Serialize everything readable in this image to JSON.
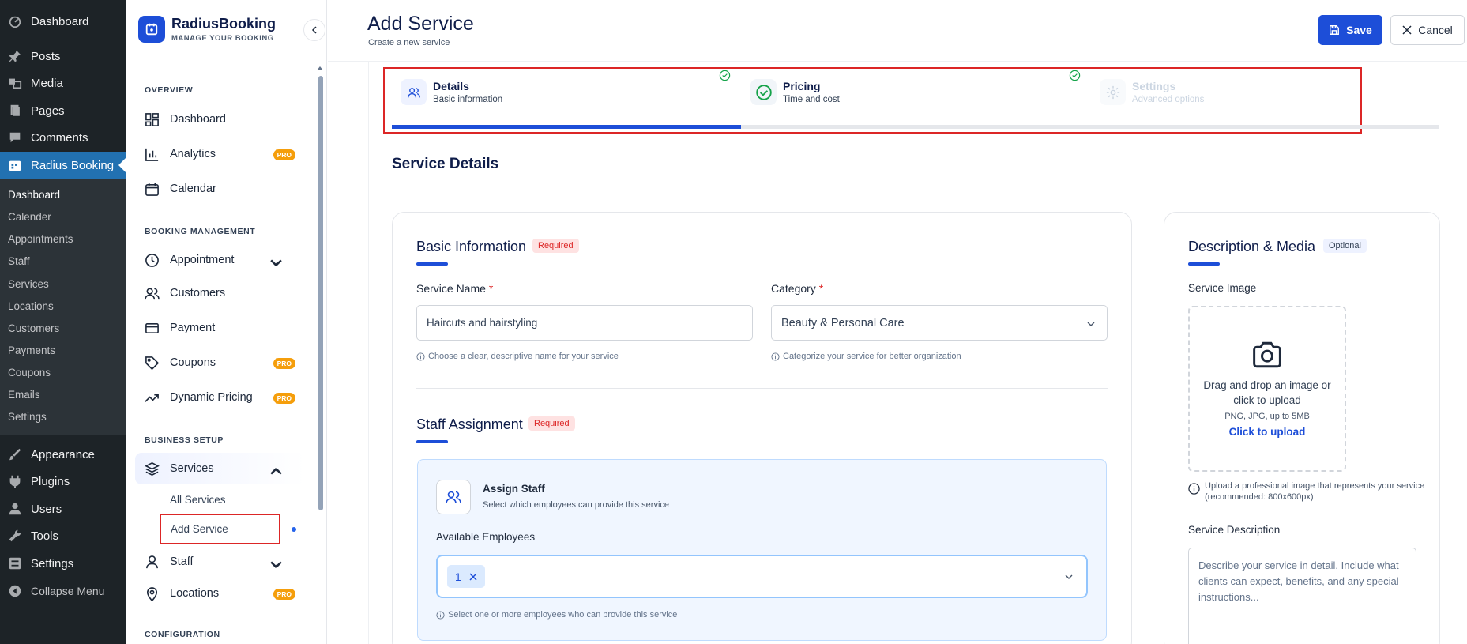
{
  "wp_menu": {
    "items": [
      {
        "label": "Dashboard",
        "icon": "dashboard-icon"
      },
      {
        "label": "Posts",
        "icon": "pin-icon"
      },
      {
        "label": "Media",
        "icon": "media-icon"
      },
      {
        "label": "Pages",
        "icon": "pages-icon"
      },
      {
        "label": "Comments",
        "icon": "comment-icon"
      },
      {
        "label": "Radius Booking",
        "icon": "calendar-icon"
      }
    ],
    "submenu": [
      "Dashboard",
      "Calender",
      "Appointments",
      "Staff",
      "Services",
      "Locations",
      "Customers",
      "Payments",
      "Coupons",
      "Emails",
      "Settings"
    ],
    "bottom": [
      {
        "label": "Appearance",
        "icon": "brush-icon"
      },
      {
        "label": "Plugins",
        "icon": "plugin-icon"
      },
      {
        "label": "Users",
        "icon": "user-icon"
      },
      {
        "label": "Tools",
        "icon": "wrench-icon"
      },
      {
        "label": "Settings",
        "icon": "settings-icon"
      },
      {
        "label": "Collapse Menu",
        "icon": "collapse-icon"
      }
    ]
  },
  "plugin": {
    "brand_name": "RadiusBooking",
    "brand_tagline": "MANAGE YOUR BOOKING",
    "sections": {
      "overview": "OVERVIEW",
      "booking": "BOOKING MANAGEMENT",
      "business": "BUSINESS SETUP",
      "config": "CONFIGURATION"
    },
    "nav": {
      "dashboard": "Dashboard",
      "analytics": "Analytics",
      "calendar": "Calendar",
      "appointment": "Appointment",
      "customers": "Customers",
      "payment": "Payment",
      "coupons": "Coupons",
      "dynamic_pricing": "Dynamic Pricing",
      "services": "Services",
      "all_services": "All Services",
      "add_service": "Add Service",
      "staff": "Staff",
      "locations": "Locations"
    },
    "pro_badge": "PRO"
  },
  "header": {
    "title": "Add Service",
    "subtitle": "Create a new service",
    "save_label": "Save",
    "cancel_label": "Cancel"
  },
  "steps": [
    {
      "label": "Details",
      "sub": "Basic information",
      "state": "active"
    },
    {
      "label": "Pricing",
      "sub": "Time and cost",
      "state": "complete"
    },
    {
      "label": "Settings",
      "sub": "Advanced options",
      "state": "pending"
    }
  ],
  "progress_fraction": 0.333,
  "section_title": "Service Details",
  "basic": {
    "title": "Basic Information",
    "required": "Required",
    "service_name_label": "Service Name",
    "service_name_value": "Haircuts and hairstyling",
    "service_name_help": "Choose a clear, descriptive name for your service",
    "category_label": "Category",
    "category_value": "Beauty & Personal Care",
    "category_help": "Categorize your service for better organization",
    "star": "*"
  },
  "staff": {
    "title": "Staff Assignment",
    "required": "Required",
    "assign_title": "Assign Staff",
    "assign_sub": "Select which employees can provide this service",
    "employees_label": "Available Employees",
    "chip": "1",
    "help": "Select one or more employees who can provide this service"
  },
  "media": {
    "title": "Description & Media",
    "optional": "Optional",
    "image_label": "Service Image",
    "drag_text": "Drag and drop an image or click to upload",
    "formats": "PNG, JPG, up to 5MB",
    "upload_link": "Click to upload",
    "image_help": "Upload a professional image that represents your service (recommended: 800x600px)",
    "desc_label": "Service Description",
    "desc_placeholder": "Describe your service in detail. Include what clients can expect, benefits, and any special instructions..."
  },
  "colors": {
    "accent": "#1d4ed8",
    "wp_bg": "#1d2327",
    "wp_active": "#2271b1",
    "required": "#dc2626",
    "pro": "#f59e0b"
  }
}
